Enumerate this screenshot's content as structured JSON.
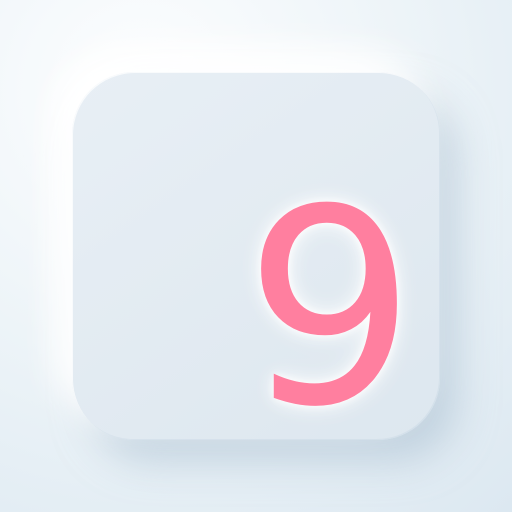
{
  "app_icon": {
    "digit": "9",
    "colors": {
      "background_light": "#fdfeff",
      "background_mid": "#edf4f8",
      "background_dark": "#dce8f1",
      "tile_top": "#e8eff5",
      "tile_bottom": "#dde7ef",
      "digit": "#ff7f9f"
    }
  }
}
